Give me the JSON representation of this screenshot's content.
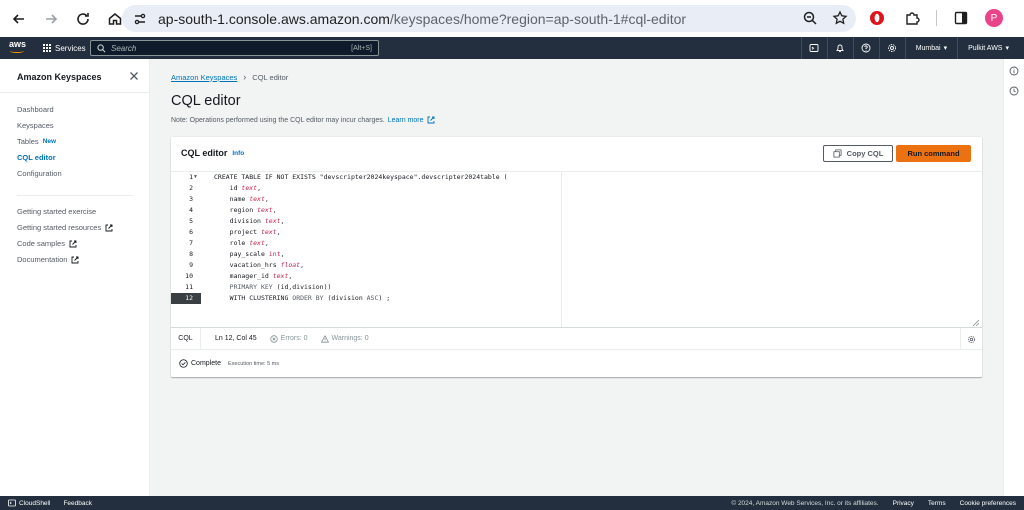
{
  "browser": {
    "url_host": "ap-south-1.console.aws.amazon.com",
    "url_path": "/keyspaces/home?region=ap-south-1#cql-editor",
    "profile_initial": "P"
  },
  "aws_header": {
    "services_label": "Services",
    "search_placeholder": "Search",
    "search_shortcut": "[Alt+S]",
    "region": "Mumbai",
    "account": "Pulkit AWS"
  },
  "sidebar": {
    "title": "Amazon Keyspaces",
    "items": [
      {
        "label": "Dashboard"
      },
      {
        "label": "Keyspaces"
      },
      {
        "label": "Tables",
        "badge": "New"
      },
      {
        "label": "CQL editor"
      },
      {
        "label": "Configuration"
      }
    ],
    "resources": [
      {
        "label": "Getting started exercise"
      },
      {
        "label": "Getting started resources"
      },
      {
        "label": "Code samples"
      },
      {
        "label": "Documentation"
      }
    ]
  },
  "breadcrumb": {
    "root": "Amazon Keyspaces",
    "current": "CQL editor"
  },
  "page": {
    "title": "CQL editor",
    "note": "Note: Operations performed using the CQL editor may incur charges.",
    "learn_more": "Learn more"
  },
  "panel": {
    "title": "CQL editor",
    "info": "Info",
    "copy_label": "Copy CQL",
    "run_label": "Run command"
  },
  "editor": {
    "line_numbers": [
      "1",
      "2",
      "3",
      "4",
      "5",
      "6",
      "7",
      "8",
      "9",
      "10",
      "11",
      "12"
    ],
    "lines": [
      "CREATE TABLE IF NOT EXISTS \"devscripter2024keyspace\".devscripter2024table (",
      "    id text,",
      "    name text,",
      "    region text,",
      "    division text,",
      "    project text,",
      "    role text,",
      "    pay_scale int,",
      "    vacation_hrs float,",
      "    manager_id text,",
      "    PRIMARY KEY (id,division))",
      "    WITH CLUSTERING ORDER BY (division ASC) ;"
    ]
  },
  "status": {
    "language": "CQL",
    "position": "Ln 12, Col 45",
    "errors": "Errors: 0",
    "warnings": "Warnings: 0"
  },
  "result": {
    "status": "Complete",
    "execution": "Execution time: 5 ms"
  },
  "footer": {
    "cloudshell": "CloudShell",
    "feedback": "Feedback",
    "copyright": "© 2024, Amazon Web Services, Inc. or its affiliates.",
    "privacy": "Privacy",
    "terms": "Terms",
    "cookies": "Cookie preferences"
  }
}
